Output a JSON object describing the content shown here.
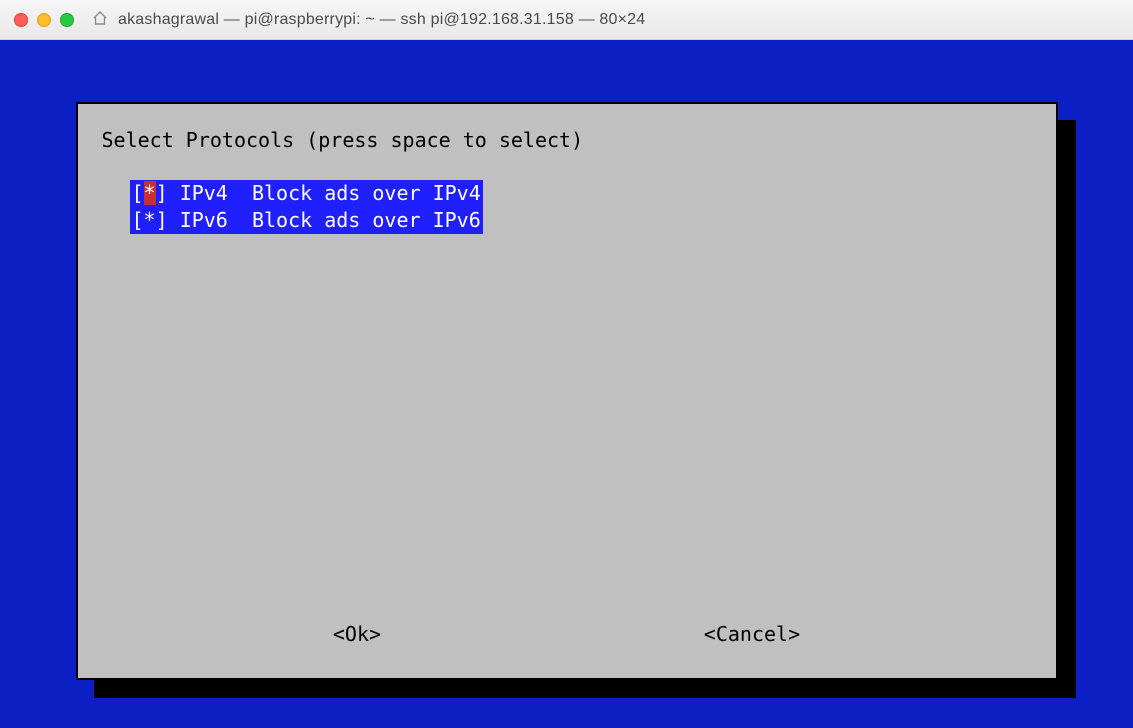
{
  "titlebar": {
    "title": "akashagrawal — pi@raspberrypi: ~ — ssh pi@192.168.31.158 — 80×24"
  },
  "dialog": {
    "title": "Select Protocols (press space to select)",
    "options": [
      {
        "mark": "*",
        "tag": "IPv4",
        "desc": "Block ads over IPv4",
        "focused": true
      },
      {
        "mark": "*",
        "tag": "IPv6",
        "desc": "Block ads over IPv6",
        "focused": false
      }
    ],
    "ok_label": "<Ok>",
    "cancel_label": "<Cancel>"
  }
}
